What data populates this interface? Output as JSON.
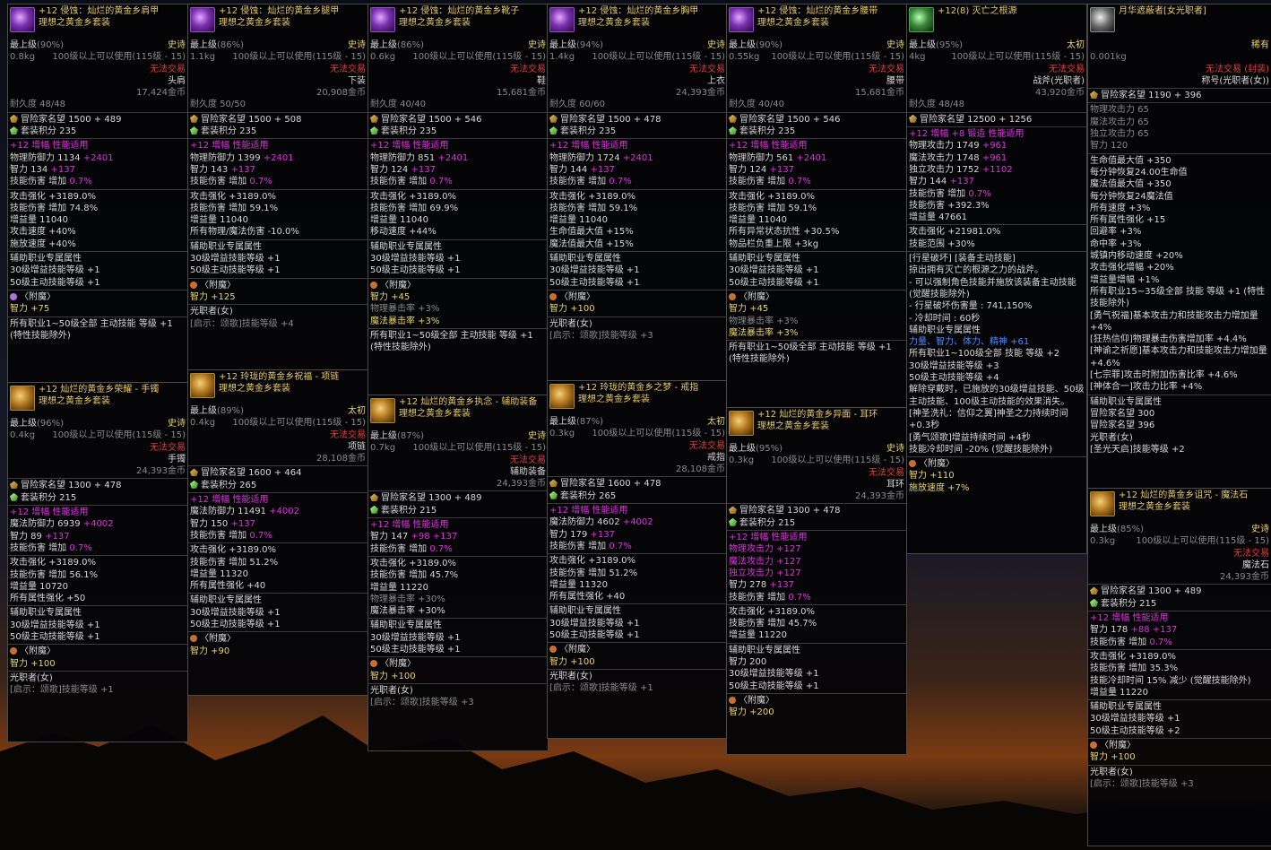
{
  "tooltips": [
    {
      "icon": "purple-shoulder-icon",
      "name": "+12 侵蚀：灿烂的黄金乡肩甲",
      "set": "理想之黄金乡套装",
      "tier": "最上级",
      "tier_pct": "(90%)",
      "rarity": "史诗",
      "weight": "0.8kg",
      "level": "100级以上可以使用(115级 - 15)",
      "trade": "无法交易",
      "slot": "头肩",
      "price": "17,424金币",
      "durability": "耐久度 48/48",
      "fame": "冒险家名望 1500 + 489",
      "set_points": "套装积分 235",
      "lines": [
        {
          "c": "m",
          "t": "+12 增幅 性能适用"
        },
        {
          "c": "g",
          "t": "物理防御力 1134 ",
          "e": "+2401"
        },
        {
          "c": "g",
          "t": "智力 134 ",
          "e": "+137"
        },
        {
          "c": "g",
          "t": "技能伤害 增加 ",
          "e": "0.7%"
        }
      ],
      "stats": [
        "攻击强化 +3189.0%",
        "技能伤害 增加 74.8%",
        "增益量 11040",
        "攻击速度 +40%",
        "施放速度 +40%"
      ],
      "aux": "辅助职业专属属性",
      "aux_lines": [
        "30级增益技能等级 +1",
        "50级主动技能等级 +1"
      ],
      "enchant": "〈附魔〉",
      "enchant_lines": [
        "智力 +75"
      ],
      "footer": [
        "所有职业1~50级全部 主动技能 等级 +1 (特性技能除外)"
      ]
    },
    {
      "icon": "golden-bracelet-icon",
      "name": "+12 灿烂的黄金乡荣耀 - 手镯",
      "set": "理想之黄金乡套装",
      "tier": "最上级",
      "tier_pct": "(96%)",
      "rarity": "史诗",
      "weight": "0.4kg",
      "level": "100级以上可以使用(115级 - 15)",
      "trade": "无法交易",
      "slot": "手镯",
      "price": "24,393金币",
      "durability": "",
      "fame": "冒险家名望 1300 + 478",
      "set_points": "套装积分 215",
      "lines": [
        {
          "c": "m",
          "t": "+12 增幅 性能适用"
        },
        {
          "c": "g",
          "t": "魔法防御力 6939 ",
          "e": "+4002"
        },
        {
          "c": "g",
          "t": "智力 89 ",
          "e": "+137"
        },
        {
          "c": "g",
          "t": "技能伤害 增加 ",
          "e": "0.7%"
        }
      ],
      "stats": [
        "攻击强化 +3189.0%",
        "技能伤害 增加 56.1%",
        "增益量 10720",
        "所有属性强化 +50"
      ],
      "aux": "辅助职业专属属性",
      "aux_lines": [
        "30级增益技能等级 +1",
        "50级主动技能等级 +1"
      ],
      "enchant": "〈附魔〉",
      "enchant_lines": [
        "智力 +100"
      ],
      "footer": [
        "光职者(女)",
        "[启示：颂歌]技能等级 +1"
      ]
    },
    {
      "icon": "purple-pants-icon",
      "name": "+12 侵蚀：灿烂的黄金乡腿甲",
      "set": "理想之黄金乡套装",
      "tier": "最上级",
      "tier_pct": "(86%)",
      "rarity": "史诗",
      "weight": "1.1kg",
      "level": "100级以上可以使用(115级 - 15)",
      "trade": "无法交易",
      "slot": "下装",
      "price": "20,908金币",
      "durability": "耐久度 50/50",
      "fame": "冒险家名望 1500 + 508",
      "set_points": "套装积分 235",
      "lines": [
        {
          "c": "m",
          "t": "+12 增幅 性能适用"
        },
        {
          "c": "g",
          "t": "物理防御力 1399 ",
          "e": "+2401"
        },
        {
          "c": "g",
          "t": "智力 143 ",
          "e": "+137"
        },
        {
          "c": "g",
          "t": "技能伤害 增加 ",
          "e": "0.7%"
        }
      ],
      "stats": [
        "攻击强化 +3189.0%",
        "技能伤害 增加 59.1%",
        "增益量 11040",
        "所有物理/魔法伤害 -10.0%"
      ],
      "aux": "辅助职业专属属性",
      "aux_lines": [
        "30级增益技能等级 +1",
        "50级主动技能等级 +1"
      ],
      "enchant": "〈附魔〉",
      "enchant_lines": [
        "智力 +125"
      ],
      "footer": [
        "光职者(女)",
        "[启示：颂歌]技能等级 +4"
      ]
    },
    {
      "icon": "gold-necklace-icon",
      "name": "+12 玲珑的黄金乡祝福 - 项链",
      "set": "理想之黄金乡套装",
      "tier": "最上级",
      "tier_pct": "(89%)",
      "rarity": "太初",
      "weight": "0.4kg",
      "level": "100级以上可以使用(115级 - 15)",
      "trade": "无法交易",
      "slot": "项链",
      "price": "28,108金币",
      "durability": "",
      "fame": "冒险家名望 1600 + 464",
      "set_points": "套装积分 265",
      "lines": [
        {
          "c": "m",
          "t": "+12 增幅 性能适用"
        },
        {
          "c": "g",
          "t": "魔法防御力 11491 ",
          "e": "+4002"
        },
        {
          "c": "g",
          "t": "智力 150 ",
          "e": "+137"
        },
        {
          "c": "g",
          "t": "技能伤害 增加 ",
          "e": "0.7%"
        }
      ],
      "stats": [
        "攻击强化 +3189.0%",
        "技能伤害 增加 51.2%",
        "增益量 11320",
        "所有属性强化 +40"
      ],
      "aux": "辅助职业专属属性",
      "aux_lines": [
        "30级增益技能等级 +1",
        "50级主动技能等级 +1"
      ],
      "enchant": "〈附魔〉",
      "enchant_lines": [
        "智力 +90"
      ],
      "footer": []
    },
    {
      "icon": "purple-boots-icon",
      "name": "+12 侵蚀：灿烂的黄金乡靴子",
      "set": "理想之黄金乡套装",
      "tier": "最上级",
      "tier_pct": "(86%)",
      "rarity": "史诗",
      "weight": "0.6kg",
      "level": "100级以上可以使用(115级 - 15)",
      "trade": "无法交易",
      "slot": "鞋",
      "price": "15,681金币",
      "durability": "耐久度 40/40",
      "fame": "冒险家名望 1500 + 546",
      "set_points": "套装积分 235",
      "lines": [
        {
          "c": "m",
          "t": "+12 增幅 性能适用"
        },
        {
          "c": "g",
          "t": "物理防御力 851 ",
          "e": "+2401"
        },
        {
          "c": "g",
          "t": "智力 124 ",
          "e": "+137"
        },
        {
          "c": "g",
          "t": "技能伤害 增加 ",
          "e": "0.7%"
        }
      ],
      "stats": [
        "攻击强化 +3189.0%",
        "技能伤害 增加 69.9%",
        "增益量 11040",
        "移动速度 +44%"
      ],
      "aux": "辅助职业专属属性",
      "aux_lines": [
        "30级增益技能等级 +1",
        "50级主动技能等级 +1"
      ],
      "enchant": "〈附魔〉",
      "enchant_lines": [
        "智力 +45",
        "物理暴击率 +3%",
        "魔法暴击率 +3%"
      ],
      "footer": [
        "所有职业1~50级全部 主动技能 等级 +1 (特性技能除外)"
      ]
    },
    {
      "icon": "gold-relic-icon",
      "name": "+12 灿烂的黄金乡执念 - 辅助装备",
      "set": "理想之黄金乡套装",
      "tier": "最上级",
      "tier_pct": "(87%)",
      "rarity": "史诗",
      "weight": "0.7kg",
      "level": "100级以上可以使用(115级 - 15)",
      "trade": "无法交易",
      "slot": "辅助装备",
      "price": "24,393金币",
      "durability": "",
      "fame": "冒险家名望 1300 + 489",
      "set_points": "套装积分 215",
      "lines": [
        {
          "c": "m",
          "t": "+12 增幅 性能适用"
        },
        {
          "c": "g",
          "t": "智力 147 ",
          "e": "+98 +137"
        },
        {
          "c": "g",
          "t": "技能伤害 增加 ",
          "e": "0.7%"
        }
      ],
      "stats": [
        "攻击强化 +3189.0%",
        "技能伤害 增加 45.7%",
        "增益量 11220",
        "物理暴击率 +30%",
        "魔法暴击率 +30%"
      ],
      "aux": "辅助职业专属属性",
      "aux_lines": [
        "30级增益技能等级 +1",
        "50级主动技能等级 +1"
      ],
      "enchant": "〈附魔〉",
      "enchant_lines": [
        "智力 +100"
      ],
      "footer": [
        "光职者(女)",
        "[启示：颂歌]技能等级 +3"
      ]
    },
    {
      "icon": "purple-chest-icon",
      "name": "+12 侵蚀：灿烂的黄金乡胸甲",
      "set": "理想之黄金乡套装",
      "tier": "最上级",
      "tier_pct": "(94%)",
      "rarity": "史诗",
      "weight": "1.4kg",
      "level": "100级以上可以使用(115级 - 15)",
      "trade": "无法交易",
      "slot": "上衣",
      "price": "24,393金币",
      "durability": "耐久度 60/60",
      "fame": "冒险家名望 1500 + 478",
      "set_points": "套装积分 235",
      "lines": [
        {
          "c": "m",
          "t": "+12 增幅 性能适用"
        },
        {
          "c": "g",
          "t": "物理防御力 1724 ",
          "e": "+2401"
        },
        {
          "c": "g",
          "t": "智力 144 ",
          "e": "+137"
        },
        {
          "c": "g",
          "t": "技能伤害 增加 ",
          "e": "0.7%"
        }
      ],
      "stats": [
        "攻击强化 +3189.0%",
        "技能伤害 增加 59.1%",
        "增益量 11040",
        "生命值最大值 +15%",
        "魔法值最大值 +15%"
      ],
      "aux": "辅助职业专属属性",
      "aux_lines": [
        "30级增益技能等级 +1",
        "50级主动技能等级 +1"
      ],
      "enchant": "〈附魔〉",
      "enchant_lines": [
        "智力 +100"
      ],
      "footer": [
        "光职者(女)",
        "[启示：颂歌]技能等级 +3"
      ]
    },
    {
      "icon": "gold-ring-icon",
      "name": "+12 玲珑的黄金乡之梦 - 戒指",
      "set": "理想之黄金乡套装",
      "tier": "最上级",
      "tier_pct": "(87%)",
      "rarity": "太初",
      "weight": "0.3kg",
      "level": "100级以上可以使用(115级 - 15)",
      "trade": "无法交易",
      "slot": "戒指",
      "price": "28,108金币",
      "durability": "",
      "fame": "冒险家名望 1600 + 478",
      "set_points": "套装积分 265",
      "lines": [
        {
          "c": "m",
          "t": "+12 增幅 性能适用"
        },
        {
          "c": "g",
          "t": "魔法防御力 4602 ",
          "e": "+4002"
        },
        {
          "c": "g",
          "t": "智力 179 ",
          "e": "+137"
        },
        {
          "c": "g",
          "t": "技能伤害 增加 ",
          "e": "0.7%"
        }
      ],
      "stats": [
        "攻击强化 +3189.0%",
        "技能伤害 增加 51.2%",
        "增益量 11320",
        "所有属性强化 +40"
      ],
      "aux": "辅助职业专属属性",
      "aux_lines": [
        "30级增益技能等级 +1",
        "50级主动技能等级 +1"
      ],
      "enchant": "〈附魔〉",
      "enchant_lines": [
        "智力 +100"
      ],
      "footer": [
        "光职者(女)",
        "[启示：颂歌]技能等级 +1"
      ]
    },
    {
      "icon": "purple-belt-icon",
      "name": "+12 侵蚀：灿烂的黄金乡腰带",
      "set": "理想之黄金乡套装",
      "tier": "最上级",
      "tier_pct": "(90%)",
      "rarity": "史诗",
      "weight": "0.55kg",
      "level": "100级以上可以使用(115级 - 15)",
      "trade": "无法交易",
      "slot": "腰带",
      "price": "15,681金币",
      "durability": "耐久度 40/40",
      "fame": "冒险家名望 1500 + 546",
      "set_points": "套装积分 235",
      "lines": [
        {
          "c": "m",
          "t": "+12 增幅 性能适用"
        },
        {
          "c": "g",
          "t": "物理防御力 561 ",
          "e": "+2401"
        },
        {
          "c": "g",
          "t": "智力 124 ",
          "e": "+137"
        },
        {
          "c": "g",
          "t": "技能伤害 增加 ",
          "e": "0.7%"
        }
      ],
      "stats": [
        "攻击强化 +3189.0%",
        "技能伤害 增加 59.1%",
        "增益量 11040",
        "所有异常状态抗性 +30.5%",
        "物品栏负重上限 +3kg"
      ],
      "aux": "辅助职业专属属性",
      "aux_lines": [
        "30级增益技能等级 +1",
        "50级主动技能等级 +1"
      ],
      "enchant": "〈附魔〉",
      "enchant_lines": [
        "智力 +45",
        "物理暴击率 +3%",
        "魔法暴击率 +3%"
      ],
      "footer": [
        "所有职业1~50级全部 主动技能 等级 +1 (特性技能除外)"
      ]
    },
    {
      "icon": "gold-earring-icon",
      "name": "+12 灿烂的黄金乡异面 - 耳环",
      "set": "理想之黄金乡套装",
      "tier": "最上级",
      "tier_pct": "(95%)",
      "rarity": "史诗",
      "weight": "0.3kg",
      "level": "100级以上可以使用(115级 - 15)",
      "trade": "无法交易",
      "slot": "耳环",
      "price": "24,393金币",
      "durability": "",
      "fame": "冒险家名望 1300 + 478",
      "set_points": "套装积分 215",
      "lines": [
        {
          "c": "m",
          "t": "+12 增幅 性能适用"
        },
        {
          "c": "m",
          "t": "物理攻击力 +127"
        },
        {
          "c": "m",
          "t": "魔法攻击力 +127"
        },
        {
          "c": "m",
          "t": "独立攻击力 +127"
        },
        {
          "c": "g",
          "t": "智力 278 ",
          "e": "+137"
        },
        {
          "c": "g",
          "t": "技能伤害 增加 ",
          "e": "0.7%"
        }
      ],
      "stats": [
        "攻击强化 +3189.0%",
        "技能伤害 增加 45.7%",
        "增益量 11220"
      ],
      "aux": "辅助职业专属属性",
      "aux_lines": [
        "智力 200",
        "30级增益技能等级 +1",
        "50级主动技能等级 +1"
      ],
      "enchant": "〈附魔〉",
      "enchant_lines": [
        "智力 +200"
      ],
      "footer": []
    },
    {
      "icon": "green-weapon-icon",
      "name": "+12(8) 灭亡之根源",
      "set": "",
      "tier": "最上级",
      "tier_pct": "(95%)",
      "rarity": "太初",
      "weight": "4kg",
      "level": "100级以上可以使用(115级 - 15)",
      "trade": "无法交易",
      "slot": "战斧(光职者)",
      "price": "43,920金币",
      "durability": "耐久度 48/48",
      "fame": "冒险家名望 12500 + 1256",
      "set_points": "",
      "lines": [
        {
          "c": "m",
          "t": "+12 增幅 +8 锻造 性能适用"
        },
        {
          "c": "g",
          "t": "物理攻击力 1749 ",
          "e": "+961"
        },
        {
          "c": "g",
          "t": "魔法攻击力 1748 ",
          "e": "+961"
        },
        {
          "c": "g",
          "t": "独立攻击力 1752 ",
          "e": "+1102"
        },
        {
          "c": "g",
          "t": "智力 144 ",
          "e": "+137"
        },
        {
          "c": "g",
          "t": "技能伤害 增加 ",
          "e": "0.7%"
        },
        {
          "c": "g",
          "t": "技能伤害 +392.3%"
        },
        {
          "c": "g",
          "t": "增益量 47661"
        }
      ],
      "stats": [
        "攻击强化 +21981.0%",
        "技能范围 +30%"
      ],
      "aux": "[行星破坏] [装备主动技能]",
      "aux_lines": [
        "掠出拥有灭亡的根源之力的战斧。",
        "- 可以强制角色技能并施放该装备主动技能 (觉醒技能除外)",
        "- 行星破坏伤害量 : 741,150%",
        "- 冷却时间 : 60秒",
        "辅助职业专属属性",
        "力量、智力、体力、精神 +61",
        "所有职业1~100级全部 技能 等级 +2",
        "30级增益技能等级 +3",
        "50级主动技能等级 +4",
        "解除穿戴时，已施放的30级增益技能、50级主动技能、100级主动技能的效果消失。",
        "[神圣洗礼：信仰之翼]神圣之力持续时间 +0.3秒",
        "[勇气颂歌]增益持续时间 +4秒",
        "技能冷却时间 -20% (觉醒技能除外)"
      ],
      "enchant": "〈附魔〉",
      "enchant_lines": [
        "智力 +110",
        "施放速度 +7%"
      ],
      "footer": []
    },
    {
      "icon": "title-icon",
      "name": "月华遮蔽者[女光职者]",
      "set": "",
      "tier": "",
      "tier_pct": "",
      "rarity": "稀有",
      "weight": "0.001kg",
      "level": "",
      "trade": "无法交易 (封装)",
      "slot": "称号(光职者(女))",
      "price": "",
      "durability": "",
      "fame": "冒险家名望 1190 + 396",
      "set_points": "",
      "lines": [
        {
          "c": "gd",
          "t": "物理攻击力 65"
        },
        {
          "c": "gd",
          "t": "魔法攻击力 65"
        },
        {
          "c": "gd",
          "t": "独立攻击力 65"
        },
        {
          "c": "gd",
          "t": "智力 120"
        }
      ],
      "stats": [
        "生命值最大值 +350",
        "每分钟恢复24.00生命值",
        "魔法值最大值 +350",
        "每分钟恢复24魔法值",
        "所有速度 +3%",
        "所有属性强化 +15",
        "回避率 +3%",
        "命中率 +3%",
        "城镇内移动速度 +20%",
        "攻击强化增幅 +20%",
        "增益量增幅 +1%",
        "所有职业15~35级全部 技能 等级 +1 (特性技能除外)",
        "[勇气祝福]基本攻击力和技能攻击力增加量 +4%",
        "[狂热信仰]物理暴击伤害增加率 +4.4%",
        "[神谕之祈愿]基本攻击力和技能攻击力增加量 +4.6%",
        "[七宗罪]攻击时附加伤害比率 +4.6%",
        "[神体合一]攻击力比率 +4%"
      ],
      "aux": "辅助职业专属属性",
      "aux_lines": [
        "冒险家名望 300",
        "冒险家名望 396",
        "光职者(女)",
        "[圣光天启]技能等级 +2"
      ],
      "enchant": "",
      "enchant_lines": [],
      "footer": []
    },
    {
      "icon": "gold-magic-stone-icon",
      "name": "+12 灿烂的黄金乡诅咒 - 魔法石",
      "set": "理想之黄金乡套装",
      "tier": "最上级",
      "tier_pct": "(85%)",
      "rarity": "史诗",
      "weight": "0.3kg",
      "level": "100级以上可以使用(115级 - 15)",
      "trade": "无法交易",
      "slot": "魔法石",
      "price": "24,393金币",
      "durability": "",
      "fame": "冒险家名望 1300 + 489",
      "set_points": "套装积分 215",
      "lines": [
        {
          "c": "m",
          "t": "+12 增幅 性能适用"
        },
        {
          "c": "g",
          "t": "智力 178 ",
          "e": "+88 +137"
        },
        {
          "c": "g",
          "t": "技能伤害 增加 ",
          "e": "0.7%"
        }
      ],
      "stats": [
        "攻击强化 +3189.0%",
        "技能伤害 增加 35.3%",
        "技能冷却时间 15% 减少 (觉醒技能除外)",
        "增益量 11220"
      ],
      "aux": "辅助职业专属属性",
      "aux_lines": [
        "30级增益技能等级 +1",
        "50级主动技能等级 +2"
      ],
      "enchant": "〈附魔〉",
      "enchant_lines": [
        "智力 +100"
      ],
      "footer": [
        "光职者(女)",
        "[启示：颂歌]技能等级 +3"
      ]
    }
  ]
}
